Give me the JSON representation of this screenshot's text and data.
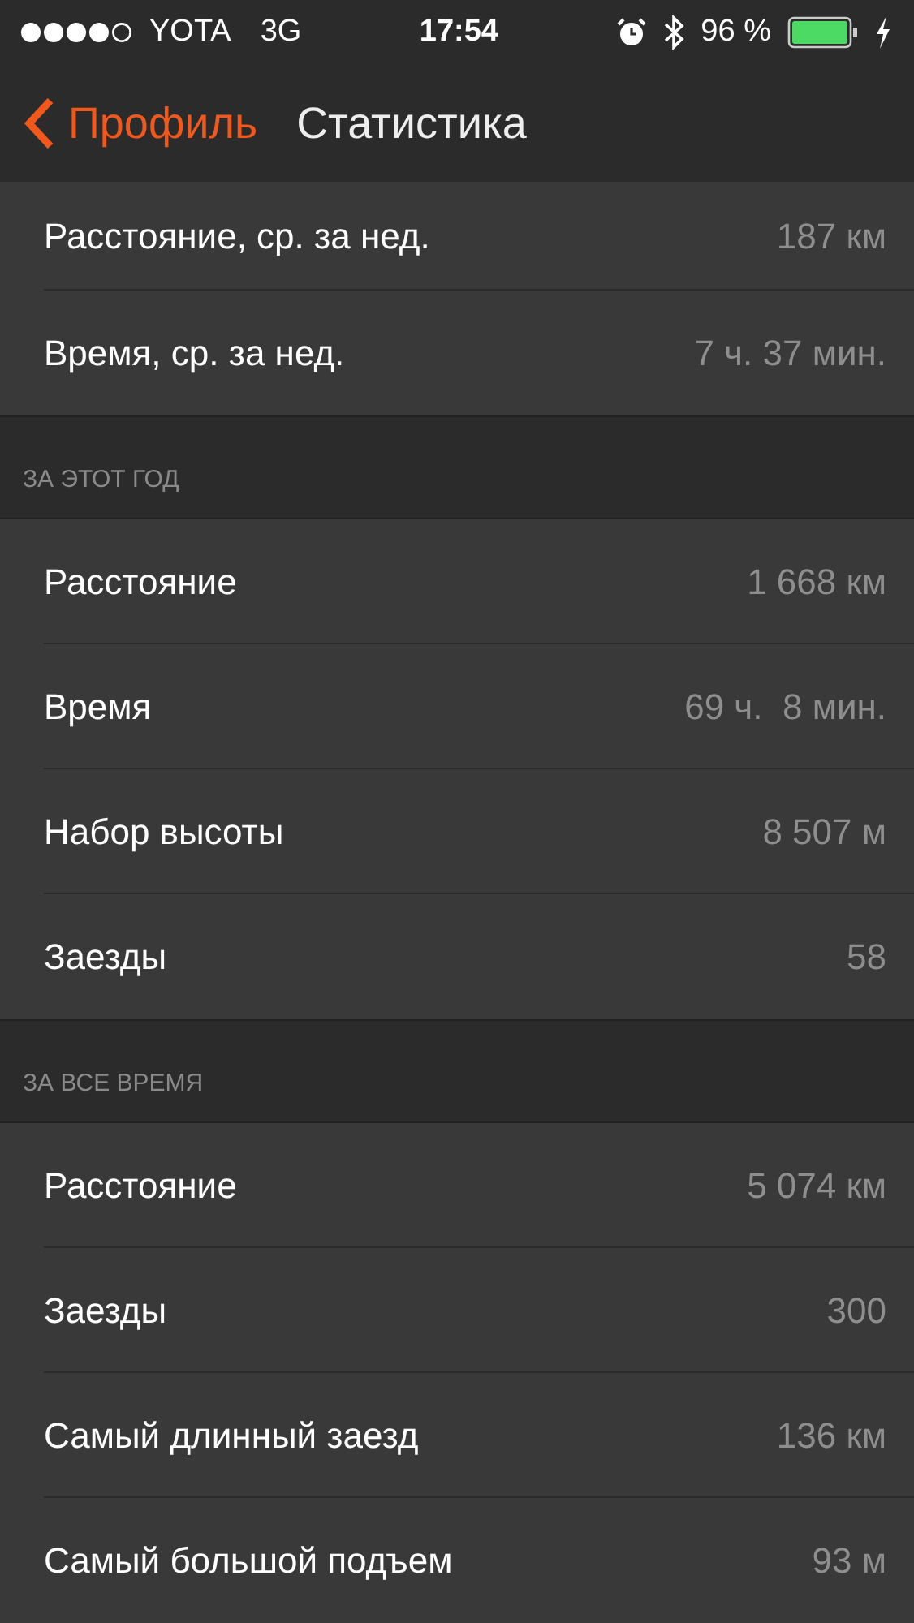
{
  "status_bar": {
    "carrier": "YOTA",
    "network": "3G",
    "time": "17:54",
    "battery": "96 %"
  },
  "nav": {
    "back": "Профиль",
    "title": "Статистика"
  },
  "sections": [
    {
      "rows": [
        {
          "label": "Расстояние, ср. за нед.",
          "value": "187 км"
        },
        {
          "label": "Время, ср. за нед.",
          "value": "7 ч. 37 мин."
        }
      ]
    },
    {
      "header": "ЗА ЭТОТ ГОД",
      "rows": [
        {
          "label": "Расстояние",
          "value": "1 668 км"
        },
        {
          "label": "Время",
          "value": "69 ч.  8 мин."
        },
        {
          "label": "Набор высоты",
          "value": "8 507 м"
        },
        {
          "label": "Заезды",
          "value": "58"
        }
      ]
    },
    {
      "header": "ЗА ВСЕ ВРЕМЯ",
      "rows": [
        {
          "label": "Расстояние",
          "value": "5 074 км"
        },
        {
          "label": "Заезды",
          "value": "300"
        },
        {
          "label": "Самый длинный заезд",
          "value": "136 км"
        },
        {
          "label": "Самый большой подъем",
          "value": "93 м"
        }
      ]
    }
  ]
}
